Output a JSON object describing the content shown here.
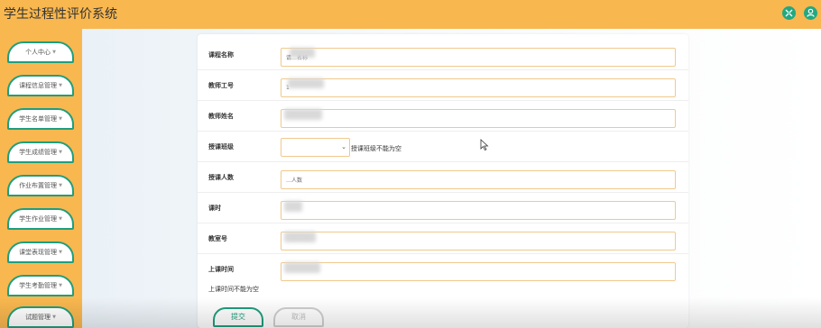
{
  "app": {
    "title": "学生过程性评价系统"
  },
  "header": {
    "icons": [
      {
        "name": "fullscreen-icon",
        "color": "#22a882"
      },
      {
        "name": "user-icon",
        "color": "#22a882"
      }
    ]
  },
  "sidebar": {
    "items": [
      {
        "label": "个人中心"
      },
      {
        "label": "课程信息管理"
      },
      {
        "label": "学生名单管理"
      },
      {
        "label": "学生成绩管理"
      },
      {
        "label": "作业布置管理"
      },
      {
        "label": "学生作业管理"
      },
      {
        "label": "课堂表现管理"
      },
      {
        "label": "学生考勤管理"
      },
      {
        "label": "试题管理"
      }
    ]
  },
  "form": {
    "fields": [
      {
        "label": "课程名称",
        "value": "请…名称"
      },
      {
        "label": "教师工号",
        "value": "1"
      },
      {
        "label": "教师姓名",
        "value": ""
      },
      {
        "label": "授课班级",
        "value": ""
      },
      {
        "label": "授课人数",
        "value": "…人数"
      },
      {
        "label": "课时",
        "value": ""
      },
      {
        "label": "教室号",
        "value": ""
      },
      {
        "label": "上课时间",
        "value": ""
      }
    ],
    "class_hint": "授课班级不能为空",
    "time_hint": "上课时间不能为空",
    "submit_label": "提交",
    "cancel_label": "取消"
  },
  "colors": {
    "accent_orange": "#f8b74f",
    "accent_green": "#1f9e7d",
    "input_border": "#f0c98d"
  }
}
